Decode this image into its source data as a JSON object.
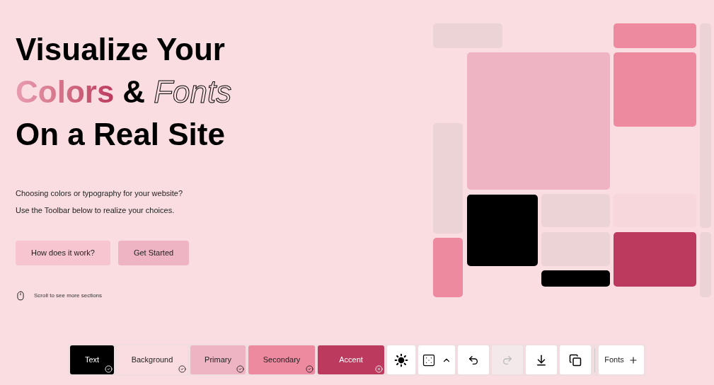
{
  "hero": {
    "title_lines": [
      [
        {
          "text": "Visualize Your",
          "kind": "plain"
        }
      ],
      [
        {
          "text": "Colors",
          "kind": "gradient"
        },
        {
          "text": "&",
          "kind": "plain"
        },
        {
          "text": "Fonts",
          "kind": "outline"
        }
      ],
      [
        {
          "text": "On a Real Site",
          "kind": "plain"
        }
      ]
    ],
    "paragraphs": [
      "Choosing colors or typography for your website?",
      "Use the Toolbar below to realize your choices."
    ],
    "buttons": [
      {
        "label": "How does it work?",
        "color": "#f6c5cf"
      },
      {
        "label": "Get Started",
        "color": "#eeb4c3"
      }
    ],
    "scroll_hint": "Scroll to see more sections"
  },
  "toolbar": {
    "swatches": [
      {
        "label": "Text",
        "color": "#000000",
        "checked": true
      },
      {
        "label": "Background",
        "color": "#fadde1",
        "checked": true
      },
      {
        "label": "Primary",
        "color": "#eeb4c3",
        "checked": true
      },
      {
        "label": "Secondary",
        "color": "#ed8a9f",
        "checked": true
      },
      {
        "label": "Accent",
        "color": "#bb3a5d",
        "checked": false
      }
    ],
    "tools": [
      {
        "kind": "theme",
        "disabled": false
      },
      {
        "kind": "random",
        "disabled": false
      },
      {
        "kind": "undo",
        "disabled": false
      },
      {
        "kind": "redo",
        "disabled": true
      },
      {
        "kind": "download",
        "disabled": false
      },
      {
        "kind": "copy",
        "disabled": false
      }
    ],
    "fonts_button": "Fonts"
  }
}
